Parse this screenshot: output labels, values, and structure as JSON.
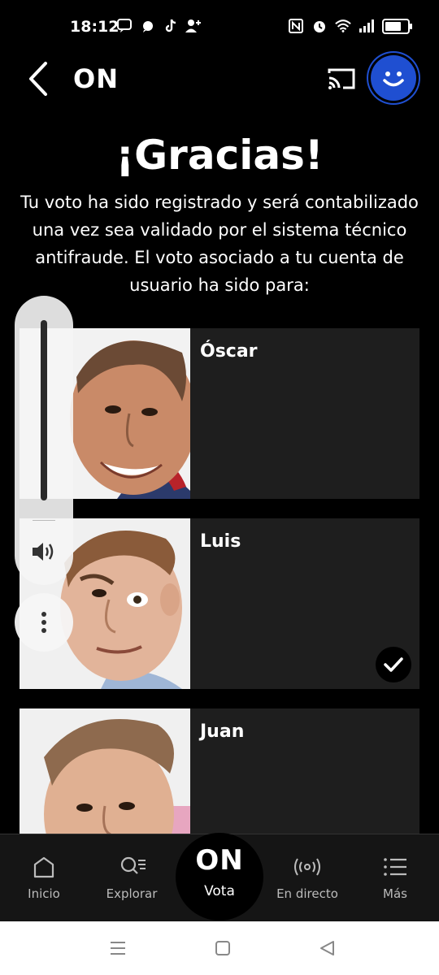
{
  "status_bar": {
    "time": "18:12",
    "left_icons": [
      "message-icon",
      "chat-bubble-icon",
      "tiktok-icon",
      "person-add-icon"
    ],
    "right_icons": [
      "nfc-icon",
      "alarm-icon",
      "wifi-icon",
      "signal-icon",
      "battery-icon"
    ],
    "battery_level": 0.85
  },
  "app_bar": {
    "title": "ON",
    "back_icon": "chevron-left-icon",
    "cast_icon": "cast-icon",
    "avatar_icon": "smiley-face-icon",
    "accent_color": "#1f4fd1"
  },
  "content": {
    "title": "¡Gracias!",
    "message": "Tu voto ha sido registrado y será contabilizado una vez sea validado por el sistema técnico antifraude. El voto asociado a tu cuenta de usuario ha sido para:"
  },
  "candidates": [
    {
      "name": "Óscar",
      "selected": false
    },
    {
      "name": "Luis",
      "selected": true
    },
    {
      "name": "Juan",
      "selected": false
    }
  ],
  "volume_overlay": {
    "level": 1.0,
    "icon": "speaker-icon",
    "more_icon": "more-vertical-icon"
  },
  "bottom_nav": {
    "items": [
      {
        "label": "Inicio",
        "icon": "home-icon"
      },
      {
        "label": "Explorar",
        "icon": "search-list-icon"
      },
      {
        "label": "Vota",
        "icon": "on-power-logo",
        "logo_text": "ON"
      },
      {
        "label": "En directo",
        "icon": "broadcast-icon"
      },
      {
        "label": "Más",
        "icon": "menu-list-icon"
      }
    ]
  },
  "system_nav": [
    "recent-apps-icon",
    "home-square-icon",
    "back-triangle-icon"
  ]
}
